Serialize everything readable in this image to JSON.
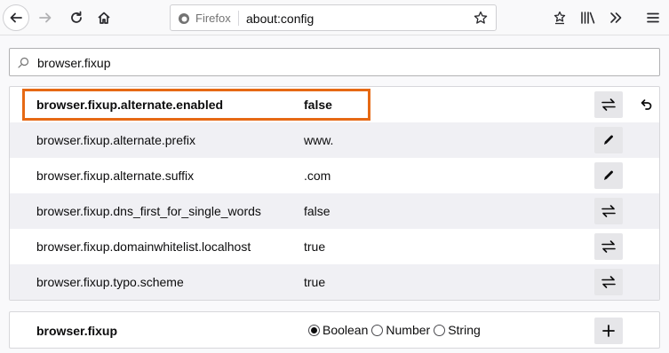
{
  "browser": {
    "identity_label": "Firefox",
    "url": "about:config"
  },
  "search": {
    "value": "browser.fixup"
  },
  "prefs": [
    {
      "name": "browser.fixup.alternate.enabled",
      "value": "false",
      "action_icon": "toggle-icon",
      "modified": true,
      "highlighted": true
    },
    {
      "name": "browser.fixup.alternate.prefix",
      "value": "www.",
      "action_icon": "edit-icon"
    },
    {
      "name": "browser.fixup.alternate.suffix",
      "value": ".com",
      "action_icon": "edit-icon"
    },
    {
      "name": "browser.fixup.dns_first_for_single_words",
      "value": "false",
      "action_icon": "toggle-icon"
    },
    {
      "name": "browser.fixup.domainwhitelist.localhost",
      "value": "true",
      "action_icon": "toggle-icon"
    },
    {
      "name": "browser.fixup.typo.scheme",
      "value": "true",
      "action_icon": "toggle-icon"
    }
  ],
  "add_pref": {
    "name": "browser.fixup",
    "types": [
      "Boolean",
      "Number",
      "String"
    ],
    "selected_type": "Boolean"
  },
  "colors": {
    "highlight": "#e66914"
  }
}
